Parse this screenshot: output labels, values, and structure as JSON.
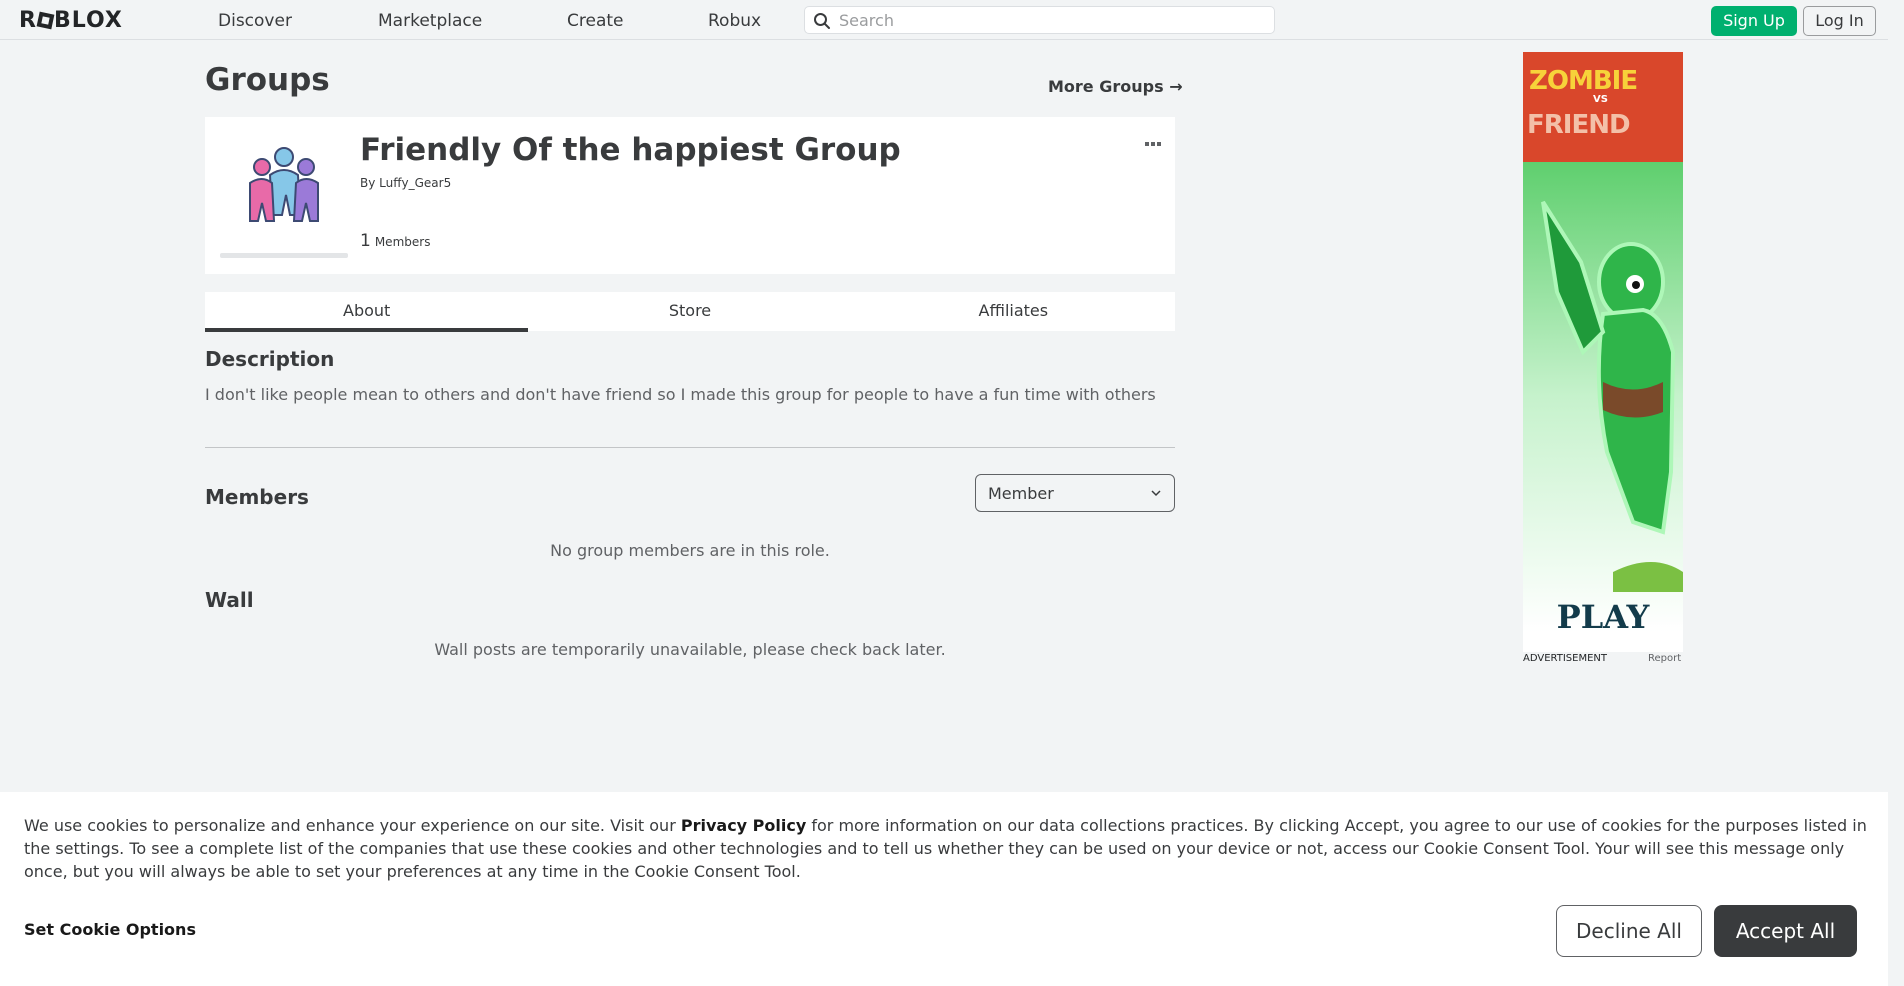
{
  "nav": {
    "logo": "ROBLOX",
    "links": [
      "Discover",
      "Marketplace",
      "Create",
      "Robux"
    ],
    "search_placeholder": "Search",
    "signup_label": "Sign Up",
    "login_label": "Log In"
  },
  "page": {
    "title": "Groups",
    "more_groups": "More Groups"
  },
  "group": {
    "name": "Friendly Of the happiest Group",
    "by_label": "By",
    "owner": "Luffy_Gear5",
    "member_count": "1",
    "members_label": "Members"
  },
  "tabs": [
    "About",
    "Store",
    "Affiliates"
  ],
  "about": {
    "description_title": "Description",
    "description": "I don't like people mean to others and don't have friend so I made this group for people to have a fun time with others",
    "members_title": "Members",
    "role_selected": "Member",
    "members_empty": "No group members are in this role.",
    "wall_title": "Wall",
    "wall_empty": "Wall posts are temporarily unavailable, please check back later."
  },
  "ad": {
    "title_top": "ZOMBIE",
    "title_vs": "VS",
    "title_bottom": "FRIEND",
    "cta": "PLAY",
    "label": "ADVERTISEMENT",
    "report": "Report"
  },
  "cookie": {
    "text_before": "We use cookies to personalize and enhance your experience on our site. Visit our ",
    "privacy_link": "Privacy Policy",
    "text_after": " for more information on our data collections practices. By clicking Accept, you agree to our use of cookies for the purposes listed in the settings. To see a complete list of the companies that use these cookies and other technologies and to tell us whether they can be used on your device or not, access our Cookie Consent Tool. Your will see this message only once, but you will always be able to set your preferences at any time in the Cookie Consent Tool.",
    "options_label": "Set Cookie Options",
    "decline_label": "Decline All",
    "accept_label": "Accept All"
  },
  "colors": {
    "signup_green": "#00b06f",
    "text_dark": "#393b3d",
    "page_bg": "#f2f4f5",
    "accept_bg": "#393b3d"
  }
}
